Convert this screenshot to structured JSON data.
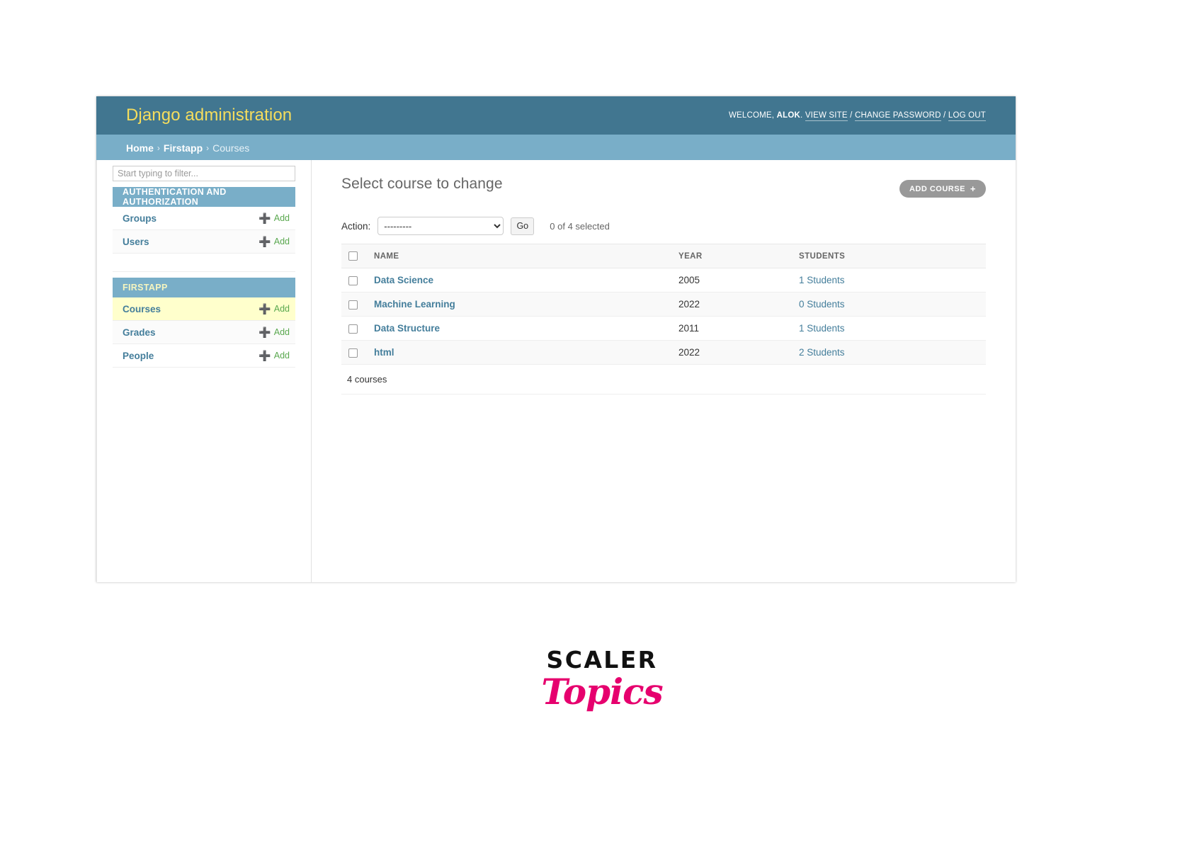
{
  "header": {
    "branding": "Django administration",
    "welcome_prefix": "WELCOME,",
    "username": "ALOK",
    "username_suffix": ".",
    "view_site": "VIEW SITE",
    "sep1": "/",
    "change_password": "CHANGE PASSWORD",
    "sep2": "/",
    "log_out": "LOG OUT"
  },
  "breadcrumbs": {
    "home": "Home",
    "sep": "›",
    "app": "Firstapp",
    "current": "Courses"
  },
  "sidebar": {
    "filter_placeholder": "Start typing to filter...",
    "filter_value": "",
    "toggle_icon": "«",
    "add_label": "Add",
    "modules": [
      {
        "caption": "AUTHENTICATION AND AUTHORIZATION",
        "models": [
          {
            "name": "Groups",
            "add": "Add",
            "current": false
          },
          {
            "name": "Users",
            "add": "Add",
            "current": false
          }
        ]
      },
      {
        "caption": "FIRSTAPP",
        "models": [
          {
            "name": "Courses",
            "add": "Add",
            "current": true
          },
          {
            "name": "Grades",
            "add": "Add",
            "current": false
          },
          {
            "name": "People",
            "add": "Add",
            "current": false
          }
        ]
      }
    ]
  },
  "main": {
    "title": "Select course to change",
    "add_button": "ADD COURSE",
    "add_button_icon": "+",
    "action_label": "Action:",
    "action_selected": "---------",
    "action_options": [
      "---------"
    ],
    "go_button": "Go",
    "selection_counter": "0 of 4 selected",
    "columns": [
      "NAME",
      "YEAR",
      "STUDENTS"
    ],
    "rows": [
      {
        "name": "Data Science",
        "year": "2005",
        "students": "1 Students"
      },
      {
        "name": "Machine Learning",
        "year": "2022",
        "students": "0 Students"
      },
      {
        "name": "Data Structure",
        "year": "2011",
        "students": "1 Students"
      },
      {
        "name": "html",
        "year": "2022",
        "students": "2 Students"
      }
    ],
    "paginator": "4 courses"
  },
  "watermark": {
    "line1": "SCALER",
    "line2": "Topics"
  },
  "colors": {
    "header_bg": "#417690",
    "breadcrumb_bg": "#79aec8",
    "brand_text": "#f5dd5d",
    "link": "#447e9b",
    "add_green": "#5aa84f",
    "current_row": "#ffffcc",
    "logo_pink": "#e6006e"
  }
}
